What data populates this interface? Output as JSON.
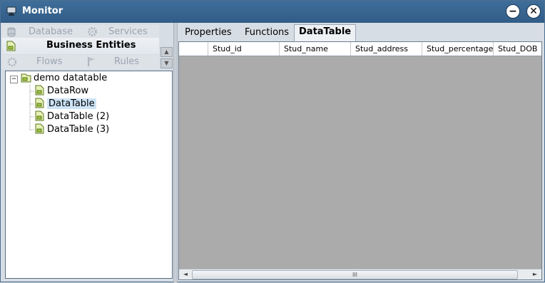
{
  "window": {
    "title": "Monitor",
    "minimize_glyph": "−",
    "close_glyph": "✕"
  },
  "left_nav": {
    "row1": [
      {
        "label": "Database",
        "icon": "database-icon"
      },
      {
        "label": "Services",
        "icon": "gear-icon"
      }
    ],
    "selected": {
      "label": "Business Entities",
      "icon": "entity-icon"
    },
    "row3": [
      {
        "label": "Flows",
        "icon": "flows-icon"
      },
      {
        "label": "Rules",
        "icon": "flag-icon"
      }
    ]
  },
  "tree": {
    "root": {
      "label": "demo datatable",
      "toggle": "−"
    },
    "children": [
      {
        "label": "DataRow"
      },
      {
        "label": "DataTable",
        "selected": true
      },
      {
        "label": "DataTable (2)"
      },
      {
        "label": "DataTable (3)"
      }
    ]
  },
  "tabs": [
    {
      "label": "Properties"
    },
    {
      "label": "Functions"
    },
    {
      "label": "DataTable",
      "active": true
    }
  ],
  "grid": {
    "columns": [
      "Stud_id",
      "Stud_name",
      "Stud_address",
      "Stud_percentage",
      "Stud_DOB"
    ],
    "rows": []
  },
  "scrollbar": {
    "left_arrow": "◄",
    "right_arrow": "►",
    "thumb_grip": "III",
    "up_arrow": "▲",
    "down_arrow": "▼"
  },
  "colors": {
    "titlebar": "#3a6792",
    "tree_selection": "#cde4f7",
    "grid_background": "#ababab"
  }
}
